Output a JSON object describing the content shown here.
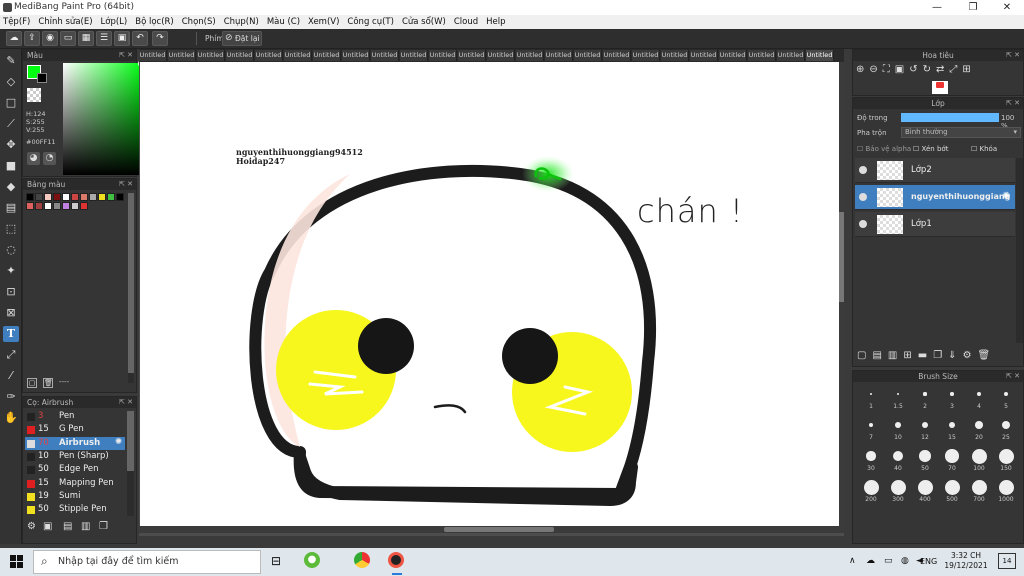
{
  "window": {
    "title": "MediBang Paint Pro (64bit)",
    "minimize": "—",
    "maximize": "❐",
    "close": "✕"
  },
  "menu": [
    "Tệp(F)",
    "Chỉnh sửa(E)",
    "Lớp(L)",
    "Bộ lọc(R)",
    "Chọn(S)",
    "Chụp(N)",
    "Màu (C)",
    "Xem(V)",
    "Công cụ(T)",
    "Cửa sổ(W)",
    "Cloud",
    "Help"
  ],
  "toolbar": {
    "key_label": "Phím",
    "reset_label": "Đặt lại"
  },
  "color_panel": {
    "title": "Màu",
    "h_label": "H:124",
    "s_label": "S:255",
    "v_label": "V:255",
    "hex": "#00FF11",
    "primary_color": "#00ff11"
  },
  "swatch_panel": {
    "title": "Bảng màu",
    "footer_text": "----"
  },
  "brush_panel": {
    "title": "Cọ: Airbrush",
    "brushes": [
      {
        "size": "3",
        "name": "Pen",
        "color": "#222222",
        "selected": false
      },
      {
        "size": "15",
        "name": "G Pen",
        "color": "#e02020",
        "selected": false
      },
      {
        "size": "70",
        "name": "Airbrush",
        "color": "#dddddd",
        "selected": true
      },
      {
        "size": "10",
        "name": "Pen (Sharp)",
        "color": "#222222",
        "selected": false
      },
      {
        "size": "50",
        "name": "Edge Pen",
        "color": "#222222",
        "selected": false
      },
      {
        "size": "15",
        "name": "Mapping Pen",
        "color": "#e02020",
        "selected": false
      },
      {
        "size": "19",
        "name": "Sumi",
        "color": "#f0e020",
        "selected": false
      },
      {
        "size": "50",
        "name": "Stipple Pen",
        "color": "#f0e020",
        "selected": false
      }
    ]
  },
  "tabs": [
    "Untitled",
    "Untitled",
    "Untitled",
    "Untitled",
    "Untitled",
    "Untitled",
    "Untitled",
    "Untitled",
    "Untitled",
    "Untitled",
    "Untitled",
    "Untitled",
    "Untitled",
    "Untitled",
    "Untitled",
    "Untitled",
    "Untitled",
    "Untitled",
    "Untitled",
    "Untitled",
    "Untitled",
    "Untitled",
    "Untitled",
    "Untitled"
  ],
  "canvas": {
    "watermark_line1": "nguyenthihuonggiang94512",
    "watermark_line2": "Hoidap247",
    "handwriting": "chán !"
  },
  "navigator": {
    "title": "Hoa tiêu"
  },
  "layers": {
    "title": "Lớp",
    "opacity_label": "Độ trong",
    "opacity_value": "100 %",
    "opacity": 1.0,
    "blend_label": "Pha trộn",
    "blend_value": "Bình thường",
    "protect_alpha": "Bảo vệ alpha",
    "clipping": "Xén bớt",
    "lock": "Khóa",
    "items": [
      {
        "name": "Lớp2",
        "selected": false
      },
      {
        "name": "nguyenthihuonggiang",
        "selected": true
      },
      {
        "name": "Lớp1",
        "selected": false
      }
    ]
  },
  "brush_size": {
    "title": "Brush Size",
    "sizes": [
      "1",
      "1.5",
      "2",
      "3",
      "4",
      "5",
      "7",
      "10",
      "12",
      "15",
      "20",
      "25",
      "30",
      "40",
      "50",
      "70",
      "100",
      "150",
      "200",
      "300",
      "400",
      "500",
      "700",
      "1000"
    ]
  },
  "taskbar": {
    "search_placeholder": "Nhập tại đây để tìm kiếm",
    "language": "ENG",
    "time": "3:32 CH",
    "date": "19/12/2021",
    "notifications": "14"
  }
}
